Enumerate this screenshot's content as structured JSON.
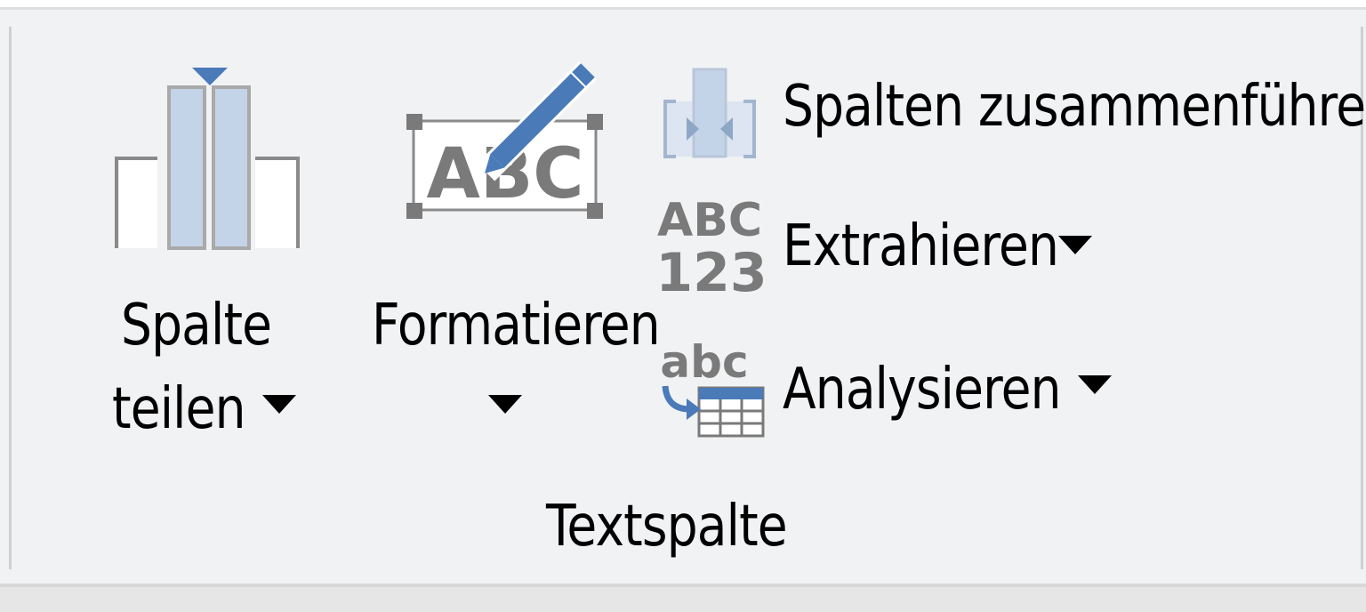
{
  "ribbon_group": {
    "title": "Textspalte",
    "buttons": {
      "split_column": {
        "line1": "Spalte",
        "line2": "teilen",
        "icon": "split-column-icon",
        "has_dropdown": true
      },
      "format": {
        "label": "Formatieren",
        "icon": "format-abc-pencil-icon",
        "icon_text": "ABC",
        "has_dropdown": true
      },
      "merge_columns": {
        "label": "Spalten zusammenführen",
        "icon": "merge-columns-icon",
        "has_dropdown": false
      },
      "extract": {
        "label": "Extrahieren",
        "icon": "abc-123-icon",
        "icon_text_top": "ABC",
        "icon_text_bottom": "123",
        "has_dropdown": true
      },
      "parse": {
        "label": "Analysieren",
        "icon": "parse-abc-table-icon",
        "icon_text": "abc",
        "has_dropdown": true
      }
    }
  },
  "colors": {
    "accent_blue": "#4a7ab8",
    "light_blue": "#c4d4e8",
    "icon_gray": "#7a7a7a",
    "text": "#000000",
    "background": "#f1f2f4"
  }
}
